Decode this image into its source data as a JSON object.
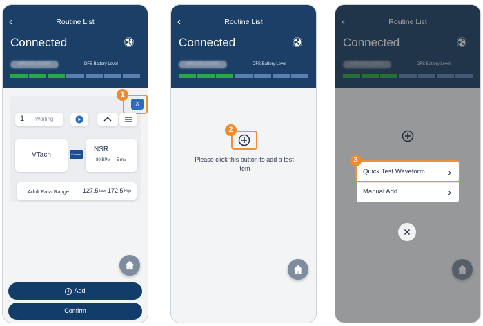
{
  "colors": {
    "header": "#1b3f66",
    "battery_fill": "#27a844",
    "battery_empty": "#5a80b2",
    "callout": "#ed8b2e",
    "button": "#123c6a"
  },
  "screen1": {
    "back_icon": "chevron-left-icon",
    "title": "Routine List",
    "connected": "Connected",
    "serial": "WBF2001-315001",
    "battery_label": "DFS Battery Level",
    "callout": "1",
    "remove_label": "X",
    "index": "1",
    "status": "Waiting···",
    "waveform": "VTach",
    "brand": "Conveni",
    "rhythm": "NSR",
    "bpm": "80 BPM",
    "mv": "5 mV",
    "range_label": "Adult Pass Range:",
    "low_value": "127.5",
    "low_label": "Low",
    "high_value": "172.5",
    "high_label": "High",
    "add_label": "Add",
    "confirm_label": "Confirm"
  },
  "screen2": {
    "title": "Routine List",
    "connected": "Connected",
    "serial": "WBF2002-215001",
    "battery_label": "DFS Battery Level",
    "callout": "2",
    "hint": "Please click this button to add a test item"
  },
  "screen3": {
    "title": "Routine List",
    "connected": "Connected",
    "serial": "WBF2001-215001",
    "battery_label": "DFS Battery Level",
    "callout": "3",
    "menu": [
      {
        "label": "Quick Test Waveform"
      },
      {
        "label": "Manual Add"
      }
    ]
  }
}
